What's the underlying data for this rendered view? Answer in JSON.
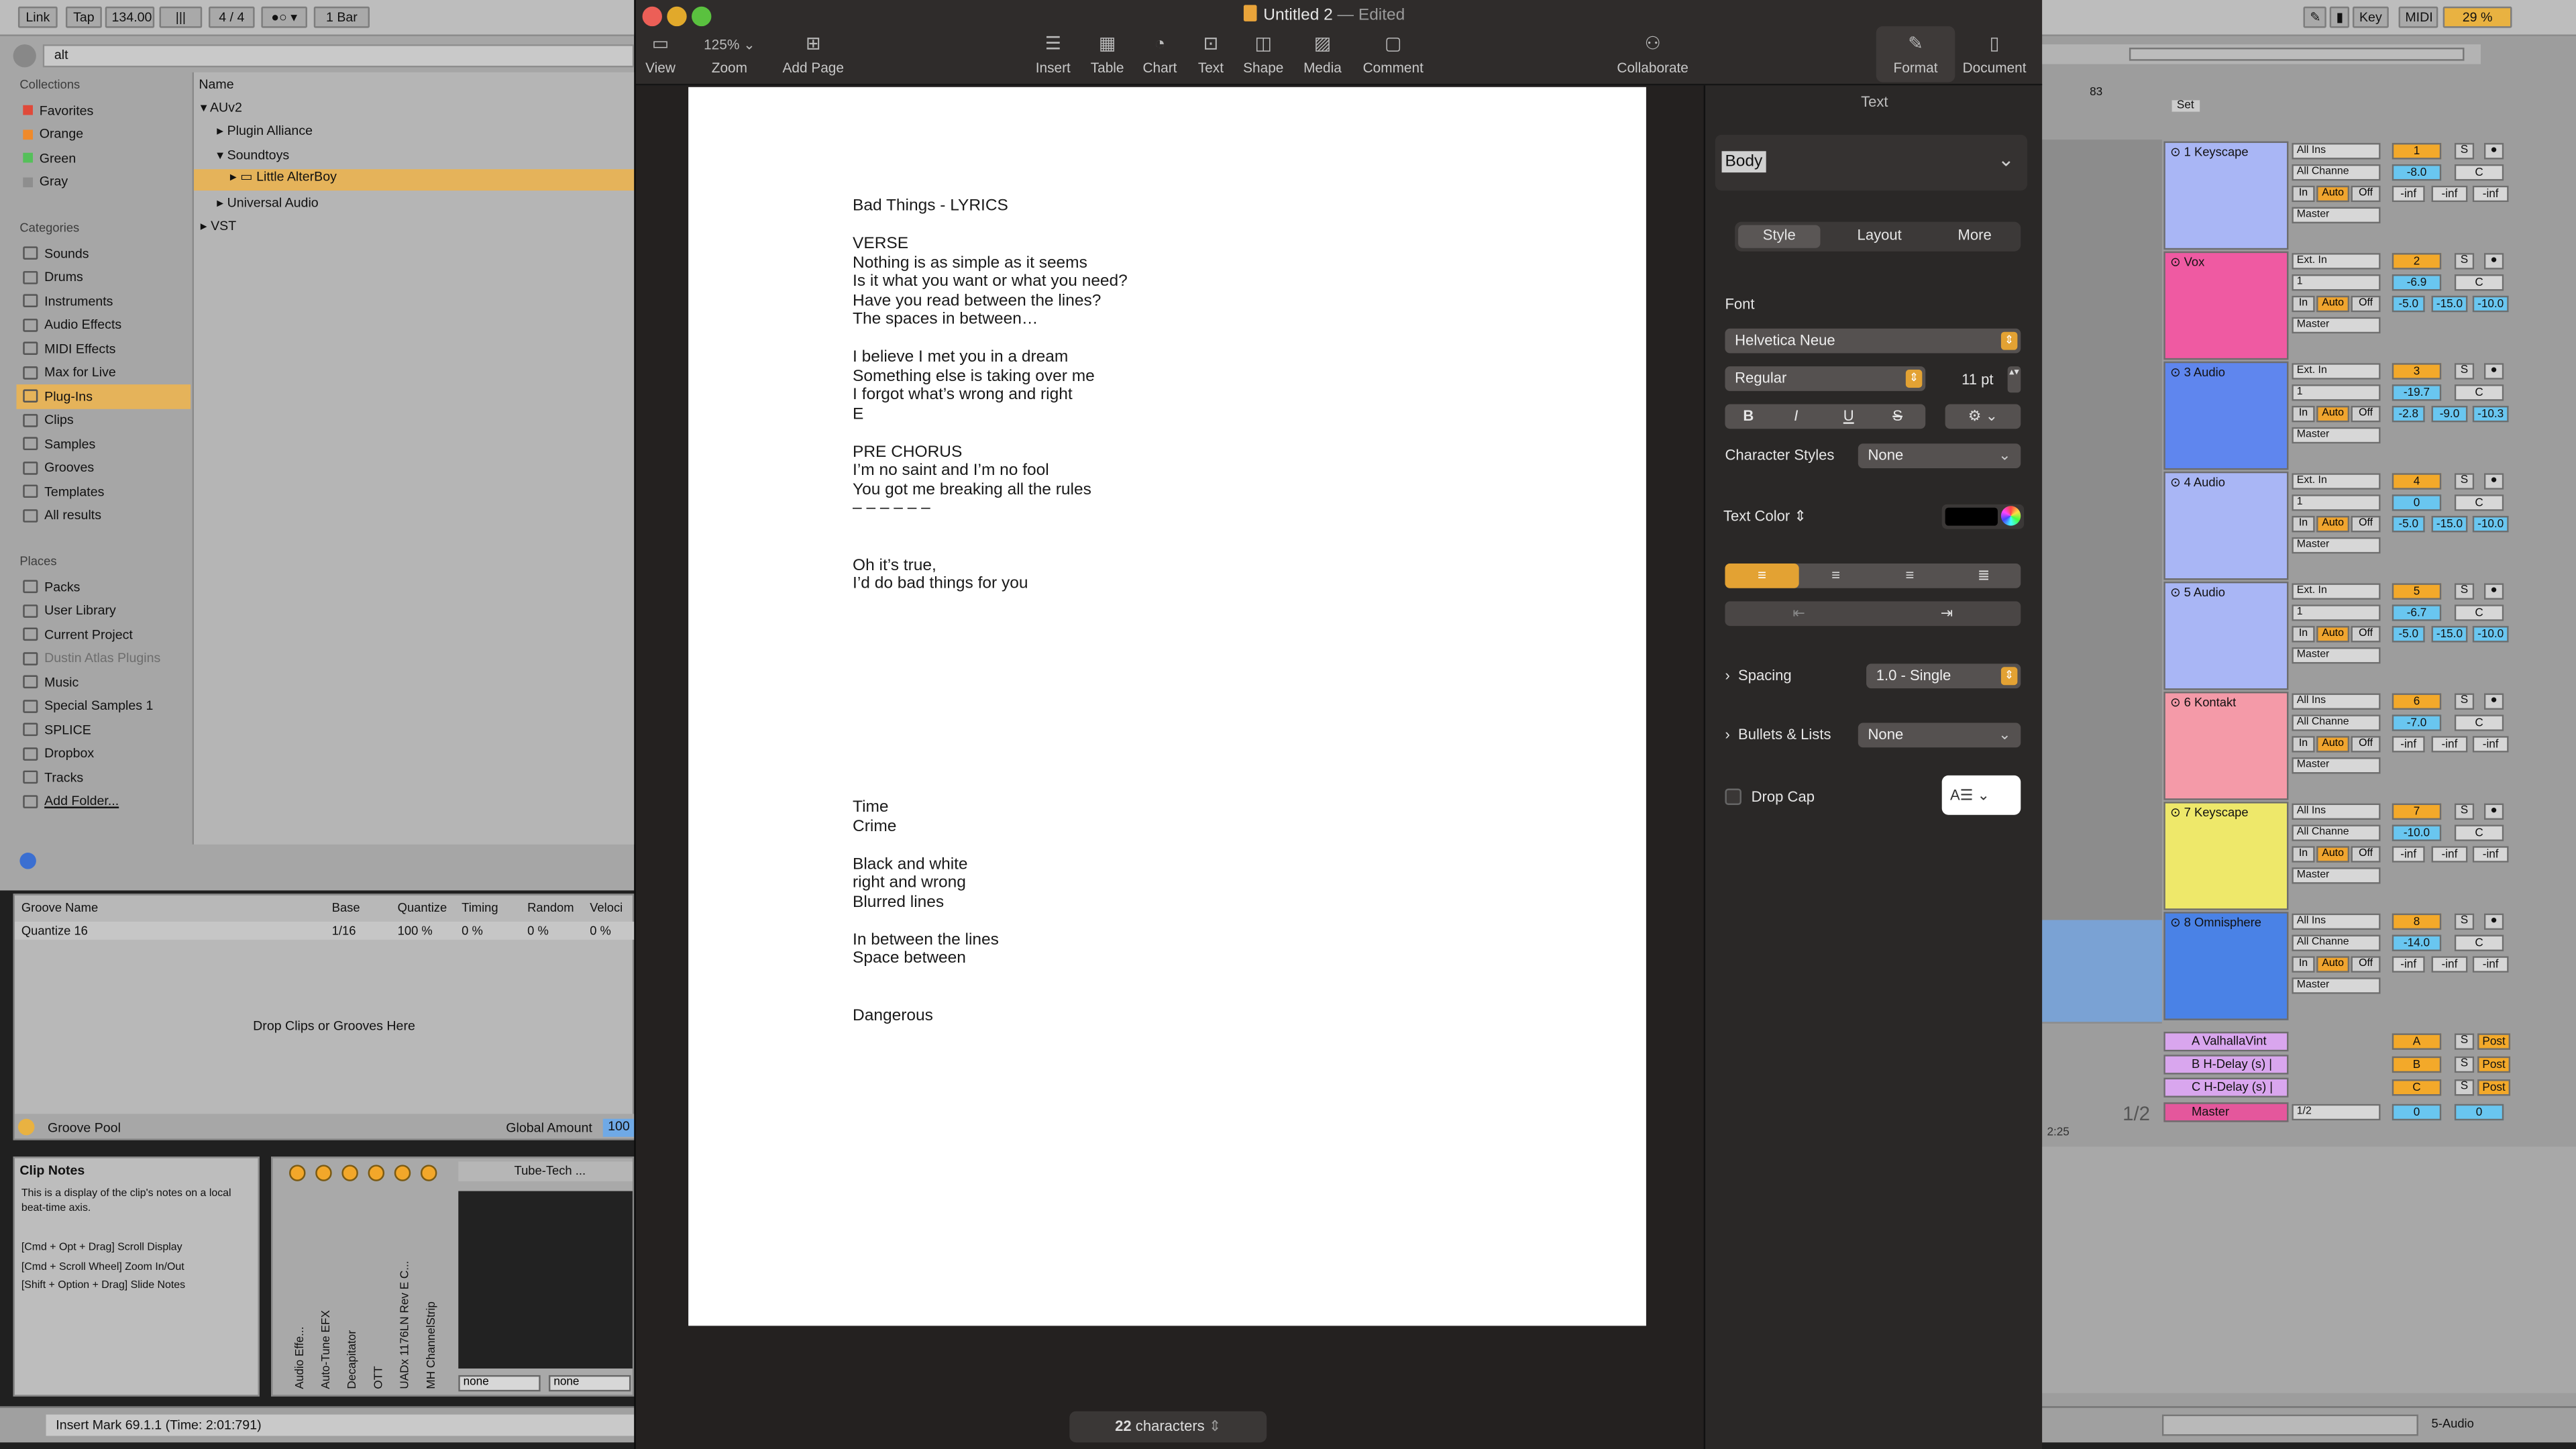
{
  "ableton": {
    "topbar": {
      "link": "Link",
      "tap": "Tap",
      "tempo": "134.00",
      "meter": "4 / 4",
      "quant": "1 Bar",
      "key": "Key",
      "midi": "MIDI",
      "cpu": "29 %"
    },
    "search_value": "alt",
    "collections_header": "Collections",
    "collections": [
      {
        "label": "Favorites",
        "color": "#e04a3a"
      },
      {
        "label": "Orange",
        "color": "#f08a2a"
      },
      {
        "label": "Green",
        "color": "#55c05a"
      },
      {
        "label": "Gray",
        "color": "#8e8e8e"
      }
    ],
    "categories_header": "Categories",
    "categories": [
      "Sounds",
      "Drums",
      "Instruments",
      "Audio Effects",
      "MIDI Effects",
      "Max for Live",
      "Plug-Ins",
      "Clips",
      "Samples",
      "Grooves",
      "Templates",
      "All results"
    ],
    "places_header": "Places",
    "places": [
      "Packs",
      "User Library",
      "Current Project",
      "Dustin Atlas Plugins",
      "Music",
      "Special Samples 1",
      "SPLICE",
      "Dropbox",
      "Tracks",
      "Add Folder..."
    ],
    "name_header": "Name",
    "tree": [
      "AUv2",
      "Plugin Alliance",
      "Soundtoys",
      "Little AlterBoy",
      "Universal Audio",
      "VST"
    ],
    "groove": {
      "headers": [
        "Groove Name",
        "Base",
        "Quantize",
        "Timing",
        "Random",
        "Veloci"
      ],
      "row": [
        "Quantize 16",
        "1/16",
        "100 %",
        "0 %",
        "0 %",
        "0 %"
      ],
      "drop_text": "Drop Clips or Grooves Here",
      "pool": "Groove Pool",
      "global_amount": "Global Amount",
      "global_value": "100"
    },
    "clip_notes": {
      "title": "Clip Notes",
      "body": "This is a display of the clip's notes on a local beat-time axis.",
      "h1": "[Cmd + Opt + Drag] Scroll Display",
      "h2": "[Cmd + Scroll Wheel] Zoom In/Out",
      "h3": "[Shift + Option + Drag] Slide Notes"
    },
    "devices": [
      "Audio Effe...",
      "Auto-Tune EFX",
      "Decapitator",
      "OTT",
      "UADx 1176LN Rev E C...",
      "MH ChannelStrip"
    ],
    "tubetech": "Tube-Tech ...",
    "none1": "none",
    "none2": "none",
    "status": "Insert Mark 69.1.1 (Time: 2:01:791)",
    "status_right": "5-Audio",
    "ruler": "83",
    "set_label": "Set",
    "time_tag": "2:25",
    "page_tag": "1/2",
    "tracks": [
      {
        "name": "1 Keyscape",
        "color": "#a9b6f5",
        "in": "All Ins",
        "ch": "All Channe",
        "num": "1",
        "vol": "-8.0",
        "s1": "-inf",
        "s2": "-inf",
        "s3": "-inf"
      },
      {
        "name": "Vox",
        "color": "#ef5aa2",
        "in": "Ext. In",
        "ch": "1",
        "num": "2",
        "vol": "-6.9",
        "s1": "-5.0",
        "s2": "-15.0",
        "s3": "-10.0"
      },
      {
        "name": "3 Audio",
        "color": "#5f86ee",
        "in": "Ext. In",
        "ch": "1",
        "num": "3",
        "vol": "-19.7",
        "s1": "-2.8",
        "s2": "-9.0",
        "s3": "-10.3"
      },
      {
        "name": "4 Audio",
        "color": "#a9b6f5",
        "in": "Ext. In",
        "ch": "1",
        "num": "4",
        "vol": "0",
        "s1": "-5.0",
        "s2": "-15.0",
        "s3": "-10.0"
      },
      {
        "name": "5 Audio",
        "color": "#a9b6f5",
        "in": "Ext. In",
        "ch": "1",
        "num": "5",
        "vol": "-6.7",
        "s1": "-5.0",
        "s2": "-15.0",
        "s3": "-10.0"
      },
      {
        "name": "6 Kontakt",
        "color": "#f49aa8",
        "in": "All Ins",
        "ch": "All Channe",
        "num": "6",
        "vol": "-7.0",
        "s1": "-inf",
        "s2": "-inf",
        "s3": "-inf"
      },
      {
        "name": "7 Keyscape",
        "color": "#eee86a",
        "in": "All Ins",
        "ch": "All Channe",
        "num": "7",
        "vol": "-10.0",
        "s1": "-inf",
        "s2": "-inf",
        "s3": "-inf"
      },
      {
        "name": "8 Omnisphere",
        "color": "#4a82e6",
        "in": "All Ins",
        "ch": "All Channe",
        "num": "8",
        "vol": "-14.0",
        "s1": "-inf",
        "s2": "-inf",
        "s3": "-inf"
      }
    ],
    "master_out": "Master",
    "in_label": "In",
    "auto_label": "Auto",
    "off_label": "Off",
    "c_label": "C",
    "s_label": "S",
    "returns": [
      {
        "name": "A ValhallaVint",
        "letter": "A"
      },
      {
        "name": "B H-Delay (s) |",
        "letter": "B"
      },
      {
        "name": "C H-Delay (s) |",
        "letter": "C"
      }
    ],
    "post": "Post",
    "master": "Master",
    "master_io": "1/2",
    "master_vals": [
      "0",
      "0"
    ]
  },
  "pages": {
    "title": "Untitled 2",
    "edited": "— Edited",
    "zoom": "125%",
    "toolbar": {
      "view": "View",
      "zoom": "Zoom",
      "add_page": "Add Page",
      "insert": "Insert",
      "table": "Table",
      "chart": "Chart",
      "text": "Text",
      "shape": "Shape",
      "media": "Media",
      "comment": "Comment",
      "collaborate": "Collaborate",
      "format": "Format",
      "document": "Document"
    },
    "doc_lines": [
      "Bad Things - LYRICS",
      "",
      "VERSE",
      "Nothing is as simple as it seems",
      "Is it what you want or what you need?",
      "Have you read between the lines?",
      "The spaces in between…",
      "",
      "I believe I met you in a dream",
      "Something else is taking over me",
      "I forgot what’s wrong and right",
      "E",
      "",
      "PRE CHORUS",
      "I’m no saint and I’m no fool",
      "You got me breaking all the rules",
      "– – – – – –",
      "",
      "",
      "Oh it’s true,",
      "I’d do bad things for you"
    ],
    "doc_lines2": [
      "Time",
      "Crime",
      "",
      "Black and white",
      "right and wrong",
      "Blurred lines",
      "",
      "In between the lines",
      "Space between",
      "",
      "",
      "Dangerous"
    ],
    "char_count": "22",
    "char_label": "characters",
    "inspector": {
      "header": "Text",
      "paragraph_style": "Body",
      "tabs": [
        "Style",
        "Layout",
        "More"
      ],
      "font_label": "Font",
      "font": "Helvetica Neue",
      "weight": "Regular",
      "size": "11 pt",
      "bold": "B",
      "italic": "I",
      "underline": "U",
      "strike": "S",
      "char_styles_label": "Character Styles",
      "char_styles": "None",
      "text_color_label": "Text Color",
      "text_color": "#000000",
      "accent": "#e3a233",
      "spacing_label": "Spacing",
      "spacing": "1.0 - Single",
      "bullets_label": "Bullets & Lists",
      "bullets": "None",
      "drop_cap_label": "Drop Cap"
    }
  }
}
